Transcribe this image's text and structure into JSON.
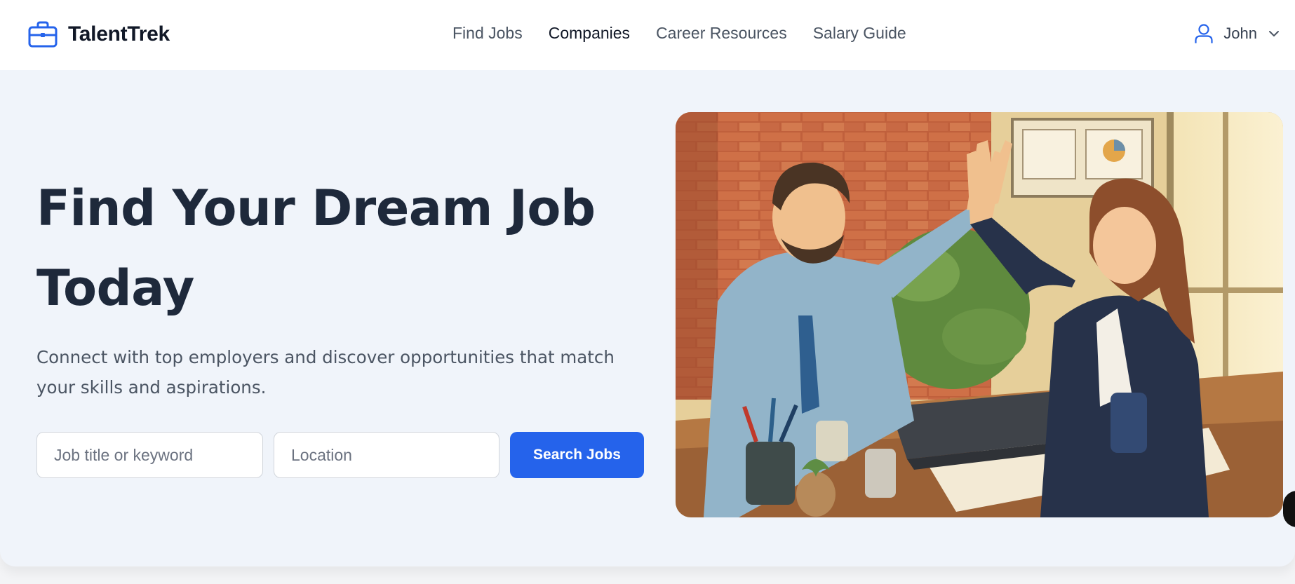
{
  "brand": {
    "name": "TalentTrek",
    "icon": "briefcase-icon",
    "color": "#2563eb"
  },
  "nav": {
    "items": [
      {
        "label": "Find Jobs",
        "active": false
      },
      {
        "label": "Companies",
        "active": true
      },
      {
        "label": "Career Resources",
        "active": false
      },
      {
        "label": "Salary Guide",
        "active": false
      }
    ]
  },
  "user": {
    "name": "John",
    "icon": "user-icon",
    "menu_icon": "chevron-down-icon"
  },
  "hero": {
    "title_line1": "Find Your Dream Job",
    "title_line2": "Today",
    "subtitle": "Connect with top employers and discover opportunities that match your skills and aspirations.",
    "search": {
      "job_placeholder": "Job title or keyword",
      "job_value": "",
      "location_placeholder": "Location",
      "location_value": "",
      "button_label": "Search Jobs"
    },
    "image": {
      "subject": "two-coworkers-high-five-illustration"
    }
  },
  "colors": {
    "accent": "#2563eb",
    "heading": "#1e293b",
    "body_text": "#4b5563",
    "hero_background": "#f0f4fa"
  }
}
